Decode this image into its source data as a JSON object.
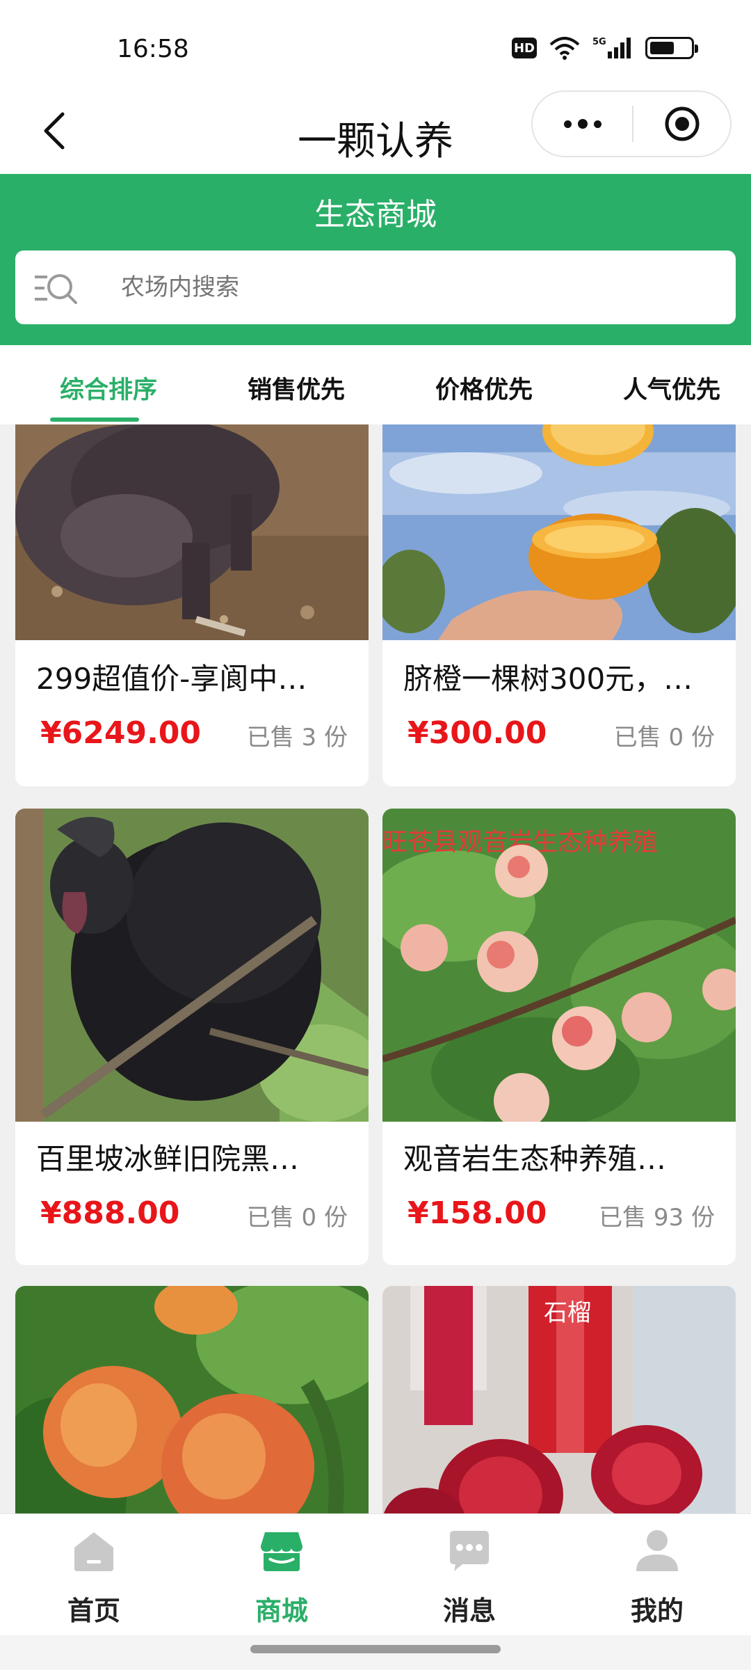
{
  "status_bar": {
    "time": "16:58",
    "hd": "HD",
    "network": "5G"
  },
  "nav": {
    "title": "一颗认养"
  },
  "header": {
    "title": "生态商城",
    "search_placeholder": "农场内搜索"
  },
  "sort_tabs": [
    {
      "label": "综合排序",
      "active": true
    },
    {
      "label": "销售优先",
      "active": false
    },
    {
      "label": "价格优先",
      "active": false
    },
    {
      "label": "人气优先",
      "active": false
    }
  ],
  "products": [
    {
      "title": "299超值价-享阆中…",
      "price": "¥6249.00",
      "sold": "已售 3 份",
      "image": "black-pig-photo"
    },
    {
      "title": "脐橙一棵树300元，…",
      "price": "¥300.00",
      "sold": "已售 0 份",
      "image": "navel-orange-photo"
    },
    {
      "title": "百里坡冰鲜旧院黑…",
      "price": "¥888.00",
      "sold": "已售 0 份",
      "image": "black-rooster-photo"
    },
    {
      "title": "观音岩生态种养殖…",
      "price": "¥158.00",
      "sold": "已售 93 份",
      "image": "peach-tree-photo",
      "image_caption": "旺苍县观音岩生态种养殖"
    },
    {
      "image": "peaches-photo"
    },
    {
      "image": "pomegranate-wine-photo",
      "image_caption": "石榴"
    }
  ],
  "tab_bar": [
    {
      "label": "首页",
      "icon": "home-icon",
      "active": false
    },
    {
      "label": "商城",
      "icon": "shop-icon",
      "active": true
    },
    {
      "label": "消息",
      "icon": "message-icon",
      "active": false
    },
    {
      "label": "我的",
      "icon": "profile-icon",
      "active": false
    }
  ],
  "colors": {
    "brand_green": "#2aaf68",
    "price_red": "#e8161a",
    "sold_gray": "#8a8a8a"
  }
}
